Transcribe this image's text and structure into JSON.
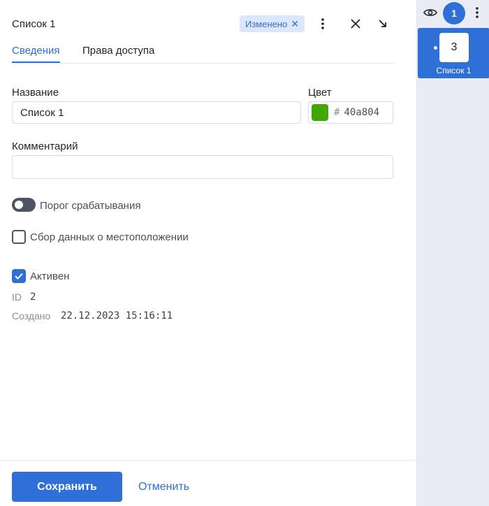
{
  "header": {
    "title": "Список 1",
    "status_badge": "Изменено",
    "badge_close_glyph": "✕"
  },
  "tabs": [
    {
      "label": "Сведения",
      "active": true
    },
    {
      "label": "Права доступа",
      "active": false
    }
  ],
  "form": {
    "name_label": "Название",
    "name_value": "Список 1",
    "color_label": "Цвет",
    "color_hash": "#",
    "color_value": "40a804",
    "color_hex": "#40a804",
    "comment_label": "Комментарий",
    "comment_value": "",
    "threshold_label": "Порог срабатывания",
    "threshold_enabled": false,
    "location_label": "Сбор данных о местоположении",
    "location_checked": false,
    "active_label": "Активен",
    "active_checked": true
  },
  "meta": {
    "id_key": "ID",
    "id_value": "2",
    "created_key": "Создано",
    "created_value": "22.12.2023 15:16:11"
  },
  "footer": {
    "save_label": "Сохранить",
    "cancel_label": "Отменить"
  },
  "sidebar": {
    "count": "1",
    "card_number": "3",
    "card_label": "Список 1"
  },
  "colors": {
    "accent": "#2f6fd8",
    "badge_bg": "#dbe8fb",
    "toggle_off": "#4d5563"
  },
  "icons": {
    "more": "more-vertical-icon",
    "close": "close-icon",
    "collapse": "arrow-down-right-icon",
    "eye": "eye-icon",
    "check": "check-icon"
  }
}
